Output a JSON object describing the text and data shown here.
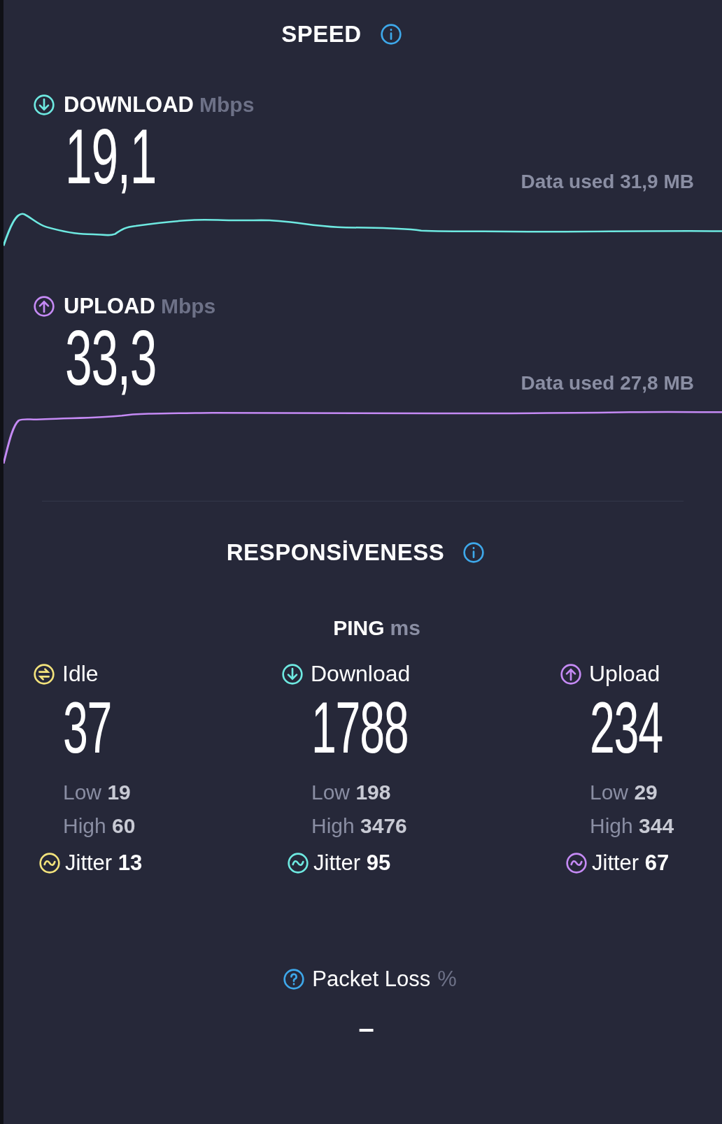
{
  "speed": {
    "title": "SPEED",
    "tests": [
      {
        "kind": "download",
        "label": "DOWNLOAD",
        "unit": "Mbps",
        "value": "19,1",
        "data_used": "Data used 31,9 MB"
      },
      {
        "kind": "upload",
        "label": "UPLOAD",
        "unit": "Mbps",
        "value": "33,3",
        "data_used": "Data used 27,8 MB"
      }
    ]
  },
  "responsiveness": {
    "title": "RESPONSİVENESS",
    "ping": {
      "label": "PING",
      "unit": "ms"
    },
    "columns": [
      {
        "kind": "idle",
        "label": "Idle",
        "value": "37",
        "low_label": "Low",
        "low": "19",
        "high_label": "High",
        "high": "60",
        "jitter_label": "Jitter",
        "jitter": "13",
        "color": "#f3e37c"
      },
      {
        "kind": "download",
        "label": "Download",
        "value": "1788",
        "low_label": "Low",
        "low": "198",
        "high_label": "High",
        "high": "3476",
        "jitter_label": "Jitter",
        "jitter": "95",
        "color": "#6ee9e1"
      },
      {
        "kind": "upload",
        "label": "Upload",
        "value": "234",
        "low_label": "Low",
        "low": "29",
        "high_label": "High",
        "high": "344",
        "jitter_label": "Jitter",
        "jitter": "67",
        "color": "#c58af5"
      }
    ]
  },
  "packet_loss": {
    "label": "Packet Loss",
    "unit": "%",
    "value": "–"
  }
}
